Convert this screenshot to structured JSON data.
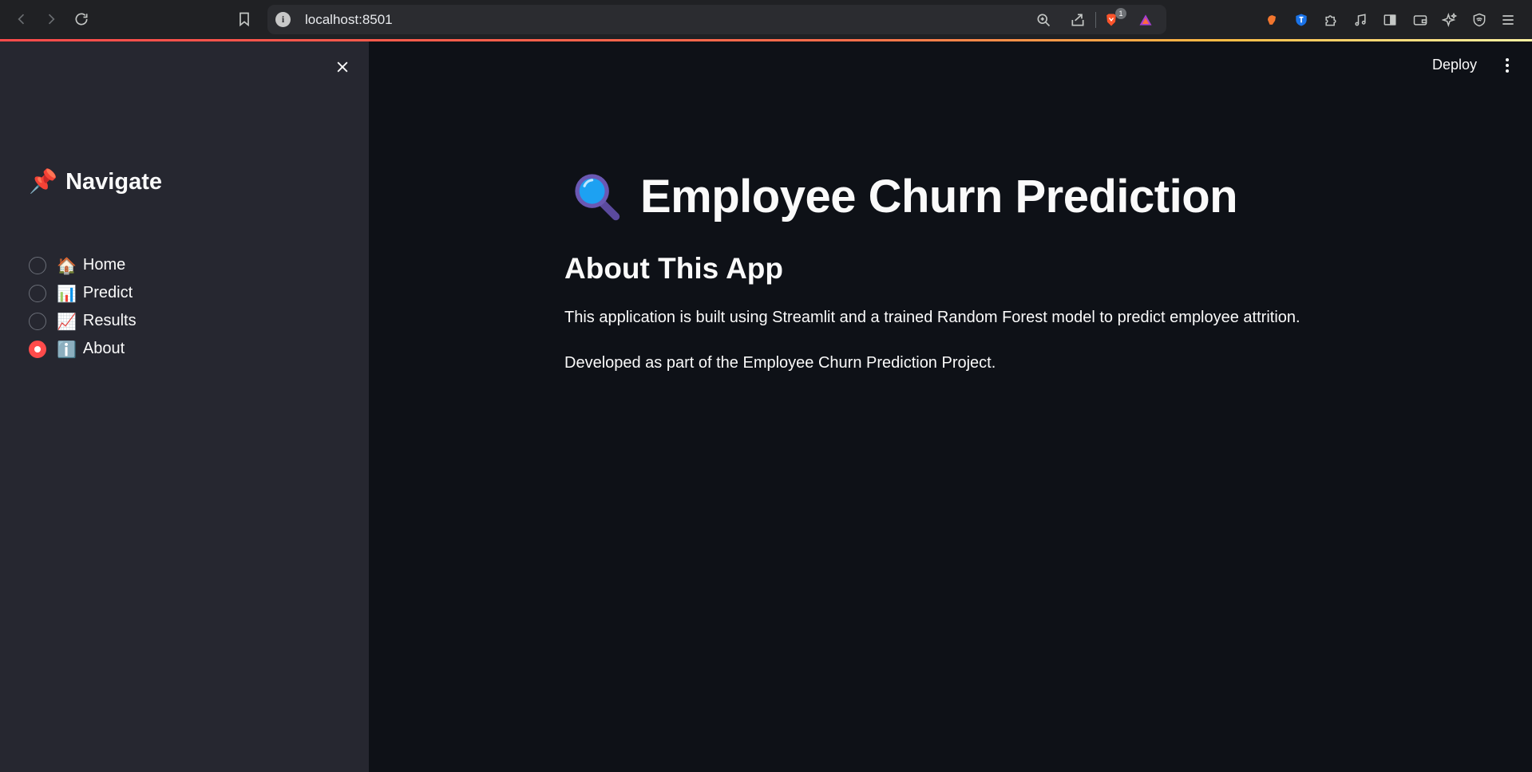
{
  "browser": {
    "url": "localhost:8501",
    "info_icon": "i",
    "brave_badge": "1"
  },
  "sidebar": {
    "title": "Navigate",
    "title_emoji": "📌",
    "options": [
      {
        "emoji": "🏠",
        "label": "Home",
        "selected": false
      },
      {
        "emoji": "📊",
        "label": "Predict",
        "selected": false
      },
      {
        "emoji": "📈",
        "label": "Results",
        "selected": false
      },
      {
        "emoji": "ℹ️",
        "label": "About",
        "selected": true
      }
    ]
  },
  "toolbar": {
    "deploy_label": "Deploy"
  },
  "main": {
    "title": "Employee Churn Prediction",
    "section_title": "About This App",
    "paragraphs": [
      "This application is built using Streamlit and a trained Random Forest model to predict employee attrition.",
      "Developed as part of the Employee Churn Prediction Project."
    ]
  },
  "colors": {
    "accent": "#ff4b4b",
    "sidebar_bg": "#262730",
    "main_bg": "#0e1117"
  }
}
